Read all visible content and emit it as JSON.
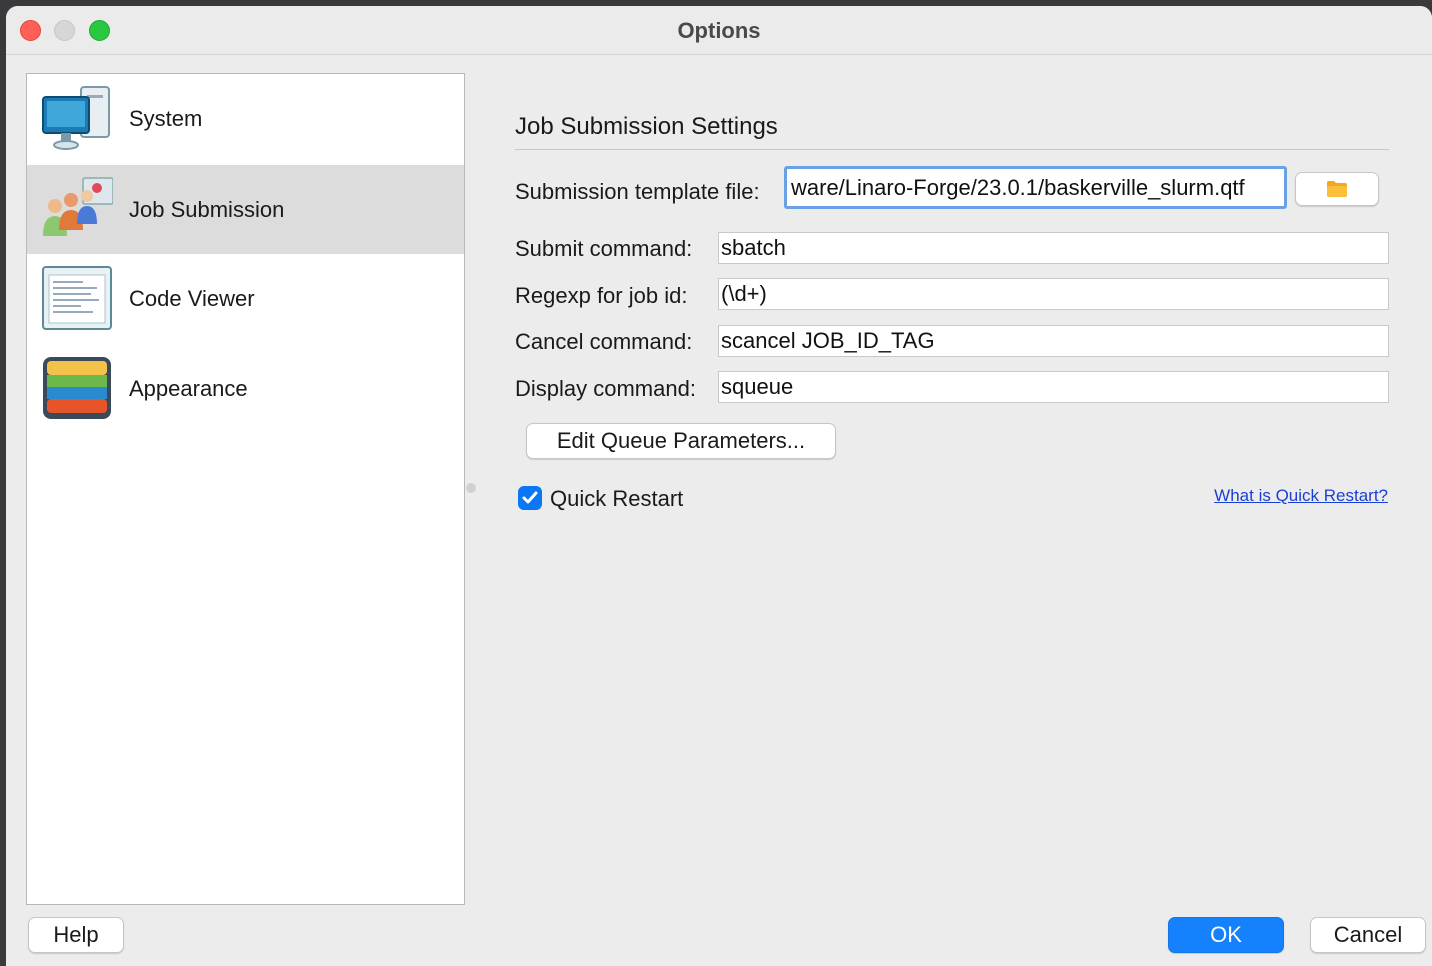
{
  "window": {
    "title": "Options"
  },
  "sidebar": {
    "items": [
      {
        "label": "System",
        "icon": "computer-icon"
      },
      {
        "label": "Job Submission",
        "icon": "users-icon",
        "selected": true
      },
      {
        "label": "Code Viewer",
        "icon": "document-icon"
      },
      {
        "label": "Appearance",
        "icon": "palette-icon"
      }
    ]
  },
  "main": {
    "section_title": "Job Submission Settings",
    "fields": {
      "template": {
        "label": "Submission template file:",
        "value": "ware/Linaro-Forge/23.0.1/baskerville_slurm.qtf"
      },
      "submit": {
        "label": "Submit command:",
        "value": "sbatch"
      },
      "regexp": {
        "label": "Regexp for job id:",
        "value": "(\\d+)"
      },
      "cancel": {
        "label": "Cancel command:",
        "value": "scancel JOB_ID_TAG"
      },
      "display": {
        "label": "Display command:",
        "value": "squeue"
      }
    },
    "edit_queue_button": "Edit Queue Parameters...",
    "quick_restart": {
      "label": "Quick Restart",
      "checked": true
    },
    "quick_restart_link": "What is Quick Restart?"
  },
  "footer": {
    "help": "Help",
    "ok": "OK",
    "cancel": "Cancel"
  },
  "colors": {
    "accent": "#1681fc",
    "checkbox": "#0a77f5",
    "link": "#1a3fd6",
    "selected_row": "#dcdcdc"
  }
}
